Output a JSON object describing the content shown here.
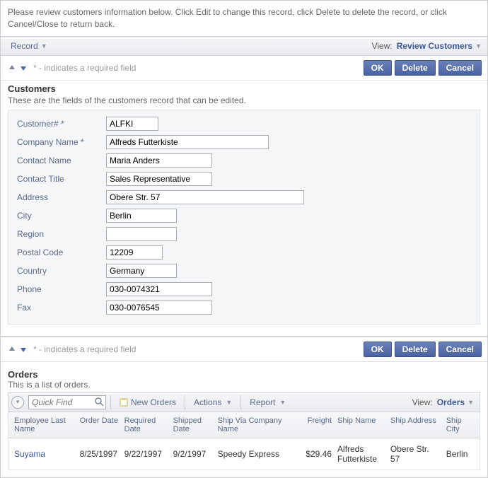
{
  "instructions": "Please review customers information below. Click Edit to change this record, click Delete to delete the record, or click Cancel/Close to return back.",
  "toolbar": {
    "record_label": "Record",
    "view_prefix": "View:",
    "view_name": "Review Customers"
  },
  "actions": {
    "required_note": "* - indicates a required field",
    "ok": "OK",
    "delete": "Delete",
    "cancel": "Cancel"
  },
  "customers": {
    "heading": "Customers",
    "sub": "These are the fields of the customers record that can be edited.",
    "fields": {
      "customer_id_label": "Customer# *",
      "customer_id": "ALFKI",
      "company_name_label": "Company Name *",
      "company_name": "Alfreds Futterkiste",
      "contact_name_label": "Contact Name",
      "contact_name": "Maria Anders",
      "contact_title_label": "Contact Title",
      "contact_title": "Sales Representative",
      "address_label": "Address",
      "address": "Obere Str. 57",
      "city_label": "City",
      "city": "Berlin",
      "region_label": "Region",
      "region": "",
      "postal_code_label": "Postal Code",
      "postal_code": "12209",
      "country_label": "Country",
      "country": "Germany",
      "phone_label": "Phone",
      "phone": "030-0074321",
      "fax_label": "Fax",
      "fax": "030-0076545"
    }
  },
  "orders": {
    "heading": "Orders",
    "sub": "This is a list of orders.",
    "quickfind_placeholder": "Quick Find",
    "new_label": "New Orders",
    "actions_label": "Actions",
    "report_label": "Report",
    "view_prefix": "View:",
    "view_name": "Orders",
    "columns": {
      "employee": "Employee Last Name",
      "order_date": "Order Date",
      "required_date": "Required Date",
      "shipped_date": "Shipped Date",
      "ship_via": "Ship Via Company Name",
      "freight": "Freight",
      "ship_name": "Ship Name",
      "ship_address": "Ship Address",
      "ship_city": "Ship City"
    },
    "rows": [
      {
        "employee": "Suyama",
        "order_date": "8/25/1997",
        "required_date": "9/22/1997",
        "shipped_date": "9/2/1997",
        "ship_via": "Speedy Express",
        "freight": "$29.46",
        "ship_name": "Alfreds Futterkiste",
        "ship_address": "Obere Str. 57",
        "ship_city": "Berlin"
      }
    ]
  }
}
